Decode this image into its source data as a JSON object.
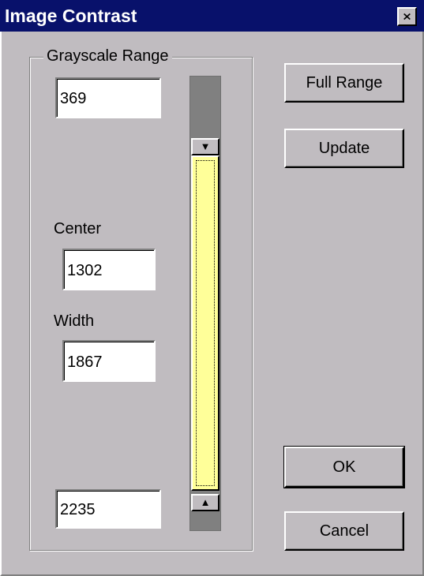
{
  "window": {
    "title": "Image Contrast",
    "close_glyph": "✕",
    "close_icon": "close-icon"
  },
  "grayscale": {
    "group_label": "Grayscale Range",
    "upper_value": "369",
    "center_label": "Center",
    "center_value": "1302",
    "width_label": "Width",
    "width_value": "1867",
    "lower_value": "2235"
  },
  "scrollbar": {
    "up_end_icon": "down-arrow-icon",
    "down_end_icon": "up-arrow-icon",
    "down_glyph": "▼",
    "up_glyph": "▲"
  },
  "buttons": {
    "full_range": "Full Range",
    "update": "Update",
    "ok": "OK",
    "cancel": "Cancel"
  },
  "colors": {
    "titlebar": "#08116b",
    "dialog_bg": "#c0bcc0",
    "thumb": "#ffff99"
  }
}
